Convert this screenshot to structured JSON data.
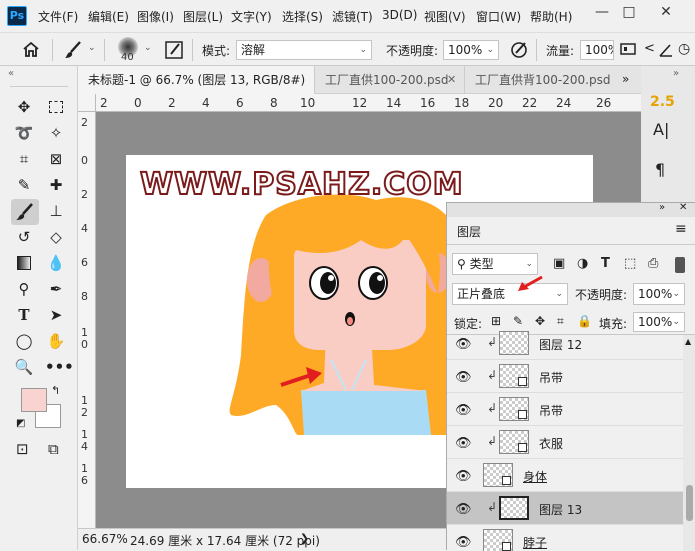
{
  "menubar": {
    "logo": "Ps",
    "items": [
      "文件(F)",
      "编辑(E)",
      "图像(I)",
      "图层(L)",
      "文字(Y)",
      "选择(S)",
      "滤镜(T)",
      "3D(D)",
      "视图(V)",
      "窗口(W)",
      "帮助(H)"
    ],
    "min": "—",
    "max": "□",
    "close": "✕"
  },
  "options": {
    "brush_size": "40",
    "mode_label": "模式:",
    "mode_value": "溶解",
    "opacity_label": "不透明度:",
    "opacity_value": "100%",
    "flow_label": "流量:",
    "flow_value": "100%"
  },
  "tabs": [
    {
      "label": "未标题-1 @ 66.7% (图层 13, RGB/8#) *",
      "active": true
    },
    {
      "label": "工厂直供100-200.psd",
      "active": false
    },
    {
      "label": "工厂直供背100-200.psd",
      "active": false
    }
  ],
  "ruler": {
    "h": [
      "2",
      "0",
      "2",
      "4",
      "6",
      "8",
      "10",
      "12",
      "14",
      "16",
      "18",
      "20",
      "22",
      "24",
      "26"
    ],
    "v": [
      "2",
      "0",
      "2",
      "4",
      "6",
      "8",
      "1",
      "0",
      "1",
      "2",
      "1",
      "4",
      "1",
      "6"
    ]
  },
  "canvas": {
    "watermark": "WWW.PSAHZ.COM"
  },
  "status": {
    "zoom": "66.67%",
    "info": "24.69 厘米 x 17.64 厘米 (72 ppi)"
  },
  "rightpanel": {
    "char_a": "A|",
    "para": "¶",
    "badge": "2.5"
  },
  "layers": {
    "title": "图层",
    "filter_label": "类型",
    "blend_mode": "正片叠底",
    "opacity_label": "不透明度:",
    "opacity_value": "100%",
    "lock_label": "锁定:",
    "fill_label": "填充:",
    "fill_value": "100%",
    "rows": [
      {
        "name": "图层 12",
        "clipped": true,
        "smart": false,
        "selected": false
      },
      {
        "name": "吊带",
        "clipped": true,
        "smart": true,
        "selected": false
      },
      {
        "name": "吊带",
        "clipped": true,
        "smart": true,
        "selected": false
      },
      {
        "name": "衣服",
        "clipped": true,
        "smart": true,
        "selected": false
      },
      {
        "name": "身体",
        "clipped": false,
        "smart": true,
        "selected": false
      },
      {
        "name": "图层 13",
        "clipped": true,
        "smart": false,
        "selected": true
      },
      {
        "name": "脖子",
        "clipped": false,
        "smart": true,
        "selected": false
      }
    ]
  },
  "colors": {
    "foreground": "#f9d3cf",
    "background": "#ffffff",
    "hair": "#ffaa26",
    "skin": "#f9cdc4",
    "dress": "#a9dcf4",
    "watermark_fill": "#ffffff",
    "watermark_stroke": "#7a1a1a"
  }
}
